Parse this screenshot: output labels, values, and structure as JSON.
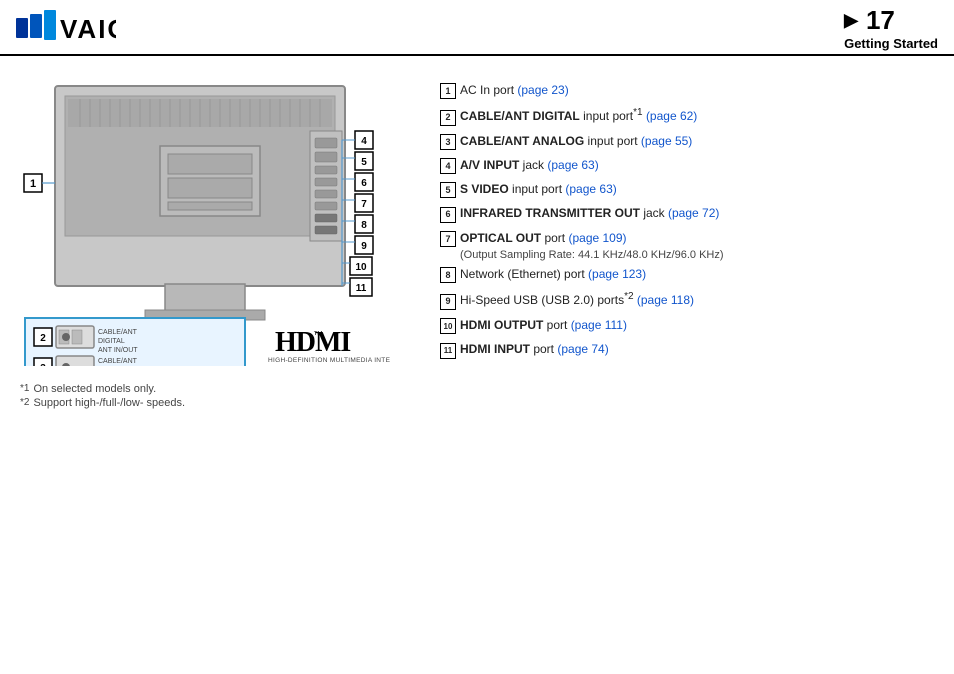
{
  "header": {
    "page_number": "17",
    "arrow": "▶",
    "section": "Getting Started"
  },
  "ports": [
    {
      "num": "1",
      "text_plain": "AC In port ",
      "text_bold": "",
      "link_text": "(page 23)",
      "link_page": "23"
    },
    {
      "num": "2",
      "text_plain": " input port",
      "text_bold": "CABLE/ANT DIGITAL",
      "sup": "*1",
      "link_text": "(page 62)",
      "link_page": "62"
    },
    {
      "num": "3",
      "text_plain": " input port ",
      "text_bold": "CABLE/ANT ANALOG",
      "link_text": "(page 55)",
      "link_page": "55"
    },
    {
      "num": "4",
      "text_plain": " jack ",
      "text_bold": "A/V INPUT",
      "link_text": "(page 63)",
      "link_page": "63"
    },
    {
      "num": "5",
      "text_plain": " input port ",
      "text_bold": "S VIDEO",
      "link_text": "(page 63)",
      "link_page": "63"
    },
    {
      "num": "6",
      "text_plain": " jack ",
      "text_bold": "INFRARED TRANSMITTER OUT",
      "link_text": "(page 72)",
      "link_page": "72"
    },
    {
      "num": "7",
      "text_plain": " port ",
      "text_bold": "OPTICAL OUT",
      "link_text": "(page 109)",
      "link_page": "109",
      "subtext": "(Output Sampling Rate: 44.1 KHz/48.0 KHz/96.0 KHz)"
    },
    {
      "num": "8",
      "text_plain": "Network (Ethernet) port ",
      "text_bold": "",
      "link_text": "(page 123)",
      "link_page": "123"
    },
    {
      "num": "9",
      "text_plain": "Hi-Speed USB (USB 2.0) ports",
      "text_bold": "",
      "sup": "*2",
      "link_text": "(page 118)",
      "link_page": "118"
    },
    {
      "num": "10",
      "text_plain": " port ",
      "text_bold": "HDMI OUTPUT",
      "link_text": "(page 111)",
      "link_page": "111"
    },
    {
      "num": "11",
      "text_plain": " port ",
      "text_bold": "HDMI INPUT",
      "link_text": "(page 74)",
      "link_page": "74"
    }
  ],
  "footnotes": [
    {
      "ref": "*1",
      "text": "On selected models only."
    },
    {
      "ref": "*2",
      "text": "Support high-/full-/low- speeds."
    }
  ],
  "hdmi": {
    "logo": "HDMI",
    "tm": "™",
    "subtitle": "HIGH-DEFINITION MULTIMEDIA INTERFACE"
  }
}
